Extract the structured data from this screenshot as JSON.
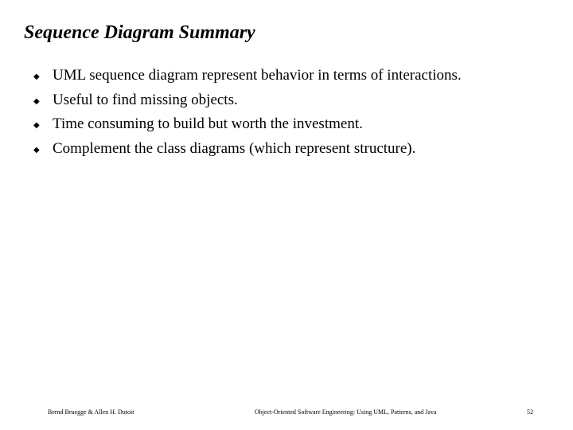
{
  "title": "Sequence Diagram Summary",
  "bullets": [
    "UML sequence diagram represent behavior in terms of interactions.",
    "Useful to find missing objects.",
    "Time consuming to build but worth the investment.",
    "Complement the class diagrams (which represent structure)."
  ],
  "footer": {
    "authors": "Bernd Bruegge & Allen H. Dutoit",
    "book": "Object-Oriented Software Engineering: Using UML, Patterns, and Java",
    "page": "52"
  }
}
